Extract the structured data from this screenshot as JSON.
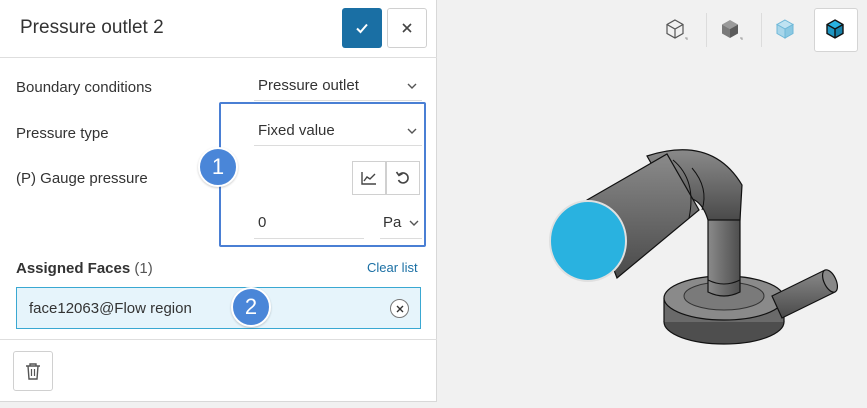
{
  "panel": {
    "title": "Pressure outlet 2",
    "confirm_icon": "checkmark-icon",
    "close_icon": "close-icon"
  },
  "fields": {
    "boundary_conditions": {
      "label": "Boundary conditions",
      "value": "Pressure outlet"
    },
    "pressure_type": {
      "label": "Pressure type",
      "value": "Fixed value"
    },
    "gauge_pressure": {
      "label": "(P) Gauge pressure",
      "value": "0",
      "unit": "Pa"
    }
  },
  "assigned_faces": {
    "title": "Assigned Faces",
    "count": "(1)",
    "clear_label": "Clear list",
    "items": [
      {
        "label": "face12063@Flow region"
      }
    ]
  },
  "badges": {
    "one": "1",
    "two": "2"
  },
  "icons": {
    "chart": "chart-icon",
    "reset": "undo-icon",
    "trash": "trash-icon",
    "chevron": "chevron-down-icon"
  },
  "viewport": {
    "buttons": [
      "wireframe-view-icon",
      "solid-view-icon",
      "transparent-view-icon",
      "edges-view-icon"
    ],
    "highlight_color": "#29b2e0",
    "model_color": "#6b6b6b"
  },
  "colors": {
    "primary": "#1a6fa4",
    "badge": "#4a86d8",
    "selection": "#e6f4fb"
  }
}
